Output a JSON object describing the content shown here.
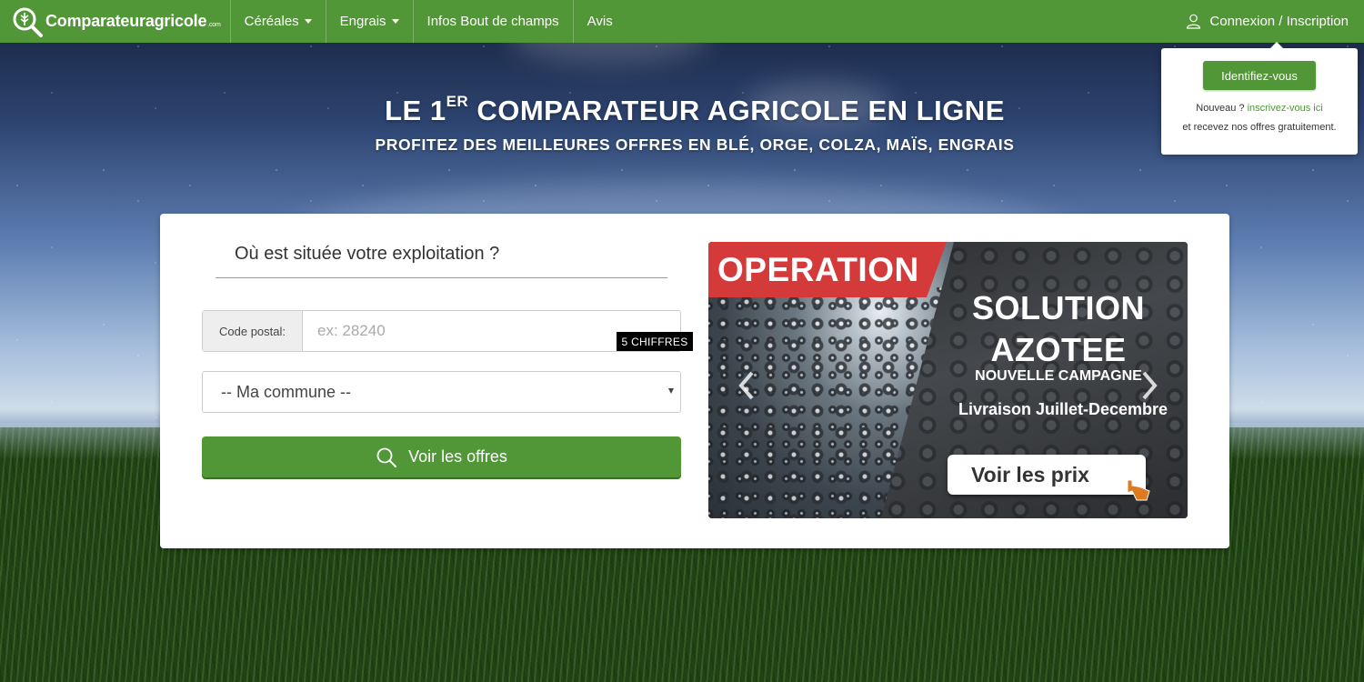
{
  "nav": {
    "brand": "Comparateuragricole",
    "brand_suffix": ".com",
    "items": [
      {
        "label": "Céréales",
        "dropdown": true
      },
      {
        "label": "Engrais",
        "dropdown": true
      },
      {
        "label": "Infos Bout de champs",
        "dropdown": false
      },
      {
        "label": "Avis",
        "dropdown": false
      }
    ],
    "login_label": "Connexion / Inscription",
    "user_icon": "user-icon"
  },
  "login_popup": {
    "button_label": "Identifiez-vous",
    "new_prefix": "Nouveau ?",
    "new_link": "inscrivez-vous ici",
    "new_suffix": "et recevez nos offres gratuitement."
  },
  "hero": {
    "title_part1": "LE 1",
    "title_sup": "ER",
    "title_part2": " COMPARATEUR AGRICOLE EN LIGNE",
    "subtitle": "PROFITEZ DES MEILLEURES OFFRES EN BLÉ, ORGE, COLZA, MAÏS, ENGRAIS"
  },
  "form": {
    "question": "Où est située votre exploitation ?",
    "postal_label": "Code postal:",
    "postal_placeholder": "ex: 28240",
    "postal_hint": "5 CHIFFRES",
    "commune_selected": "-- Ma commune --",
    "submit_label": "Voir les offres",
    "submit_icon": "search-icon"
  },
  "banner": {
    "ribbon": "OPERATION",
    "line1": "SOLUTION",
    "line2": "AZOTEE",
    "line3": "NOUVELLE CAMPAGNE",
    "line4": "Livraison Juillet-Decembre",
    "cta": "Voir les prix",
    "prev_icon": "chevron-left-icon",
    "next_icon": "chevron-right-icon"
  },
  "colors": {
    "brand_green": "#519637",
    "ribbon_red": "#d33a39",
    "hint_black": "#000000"
  }
}
